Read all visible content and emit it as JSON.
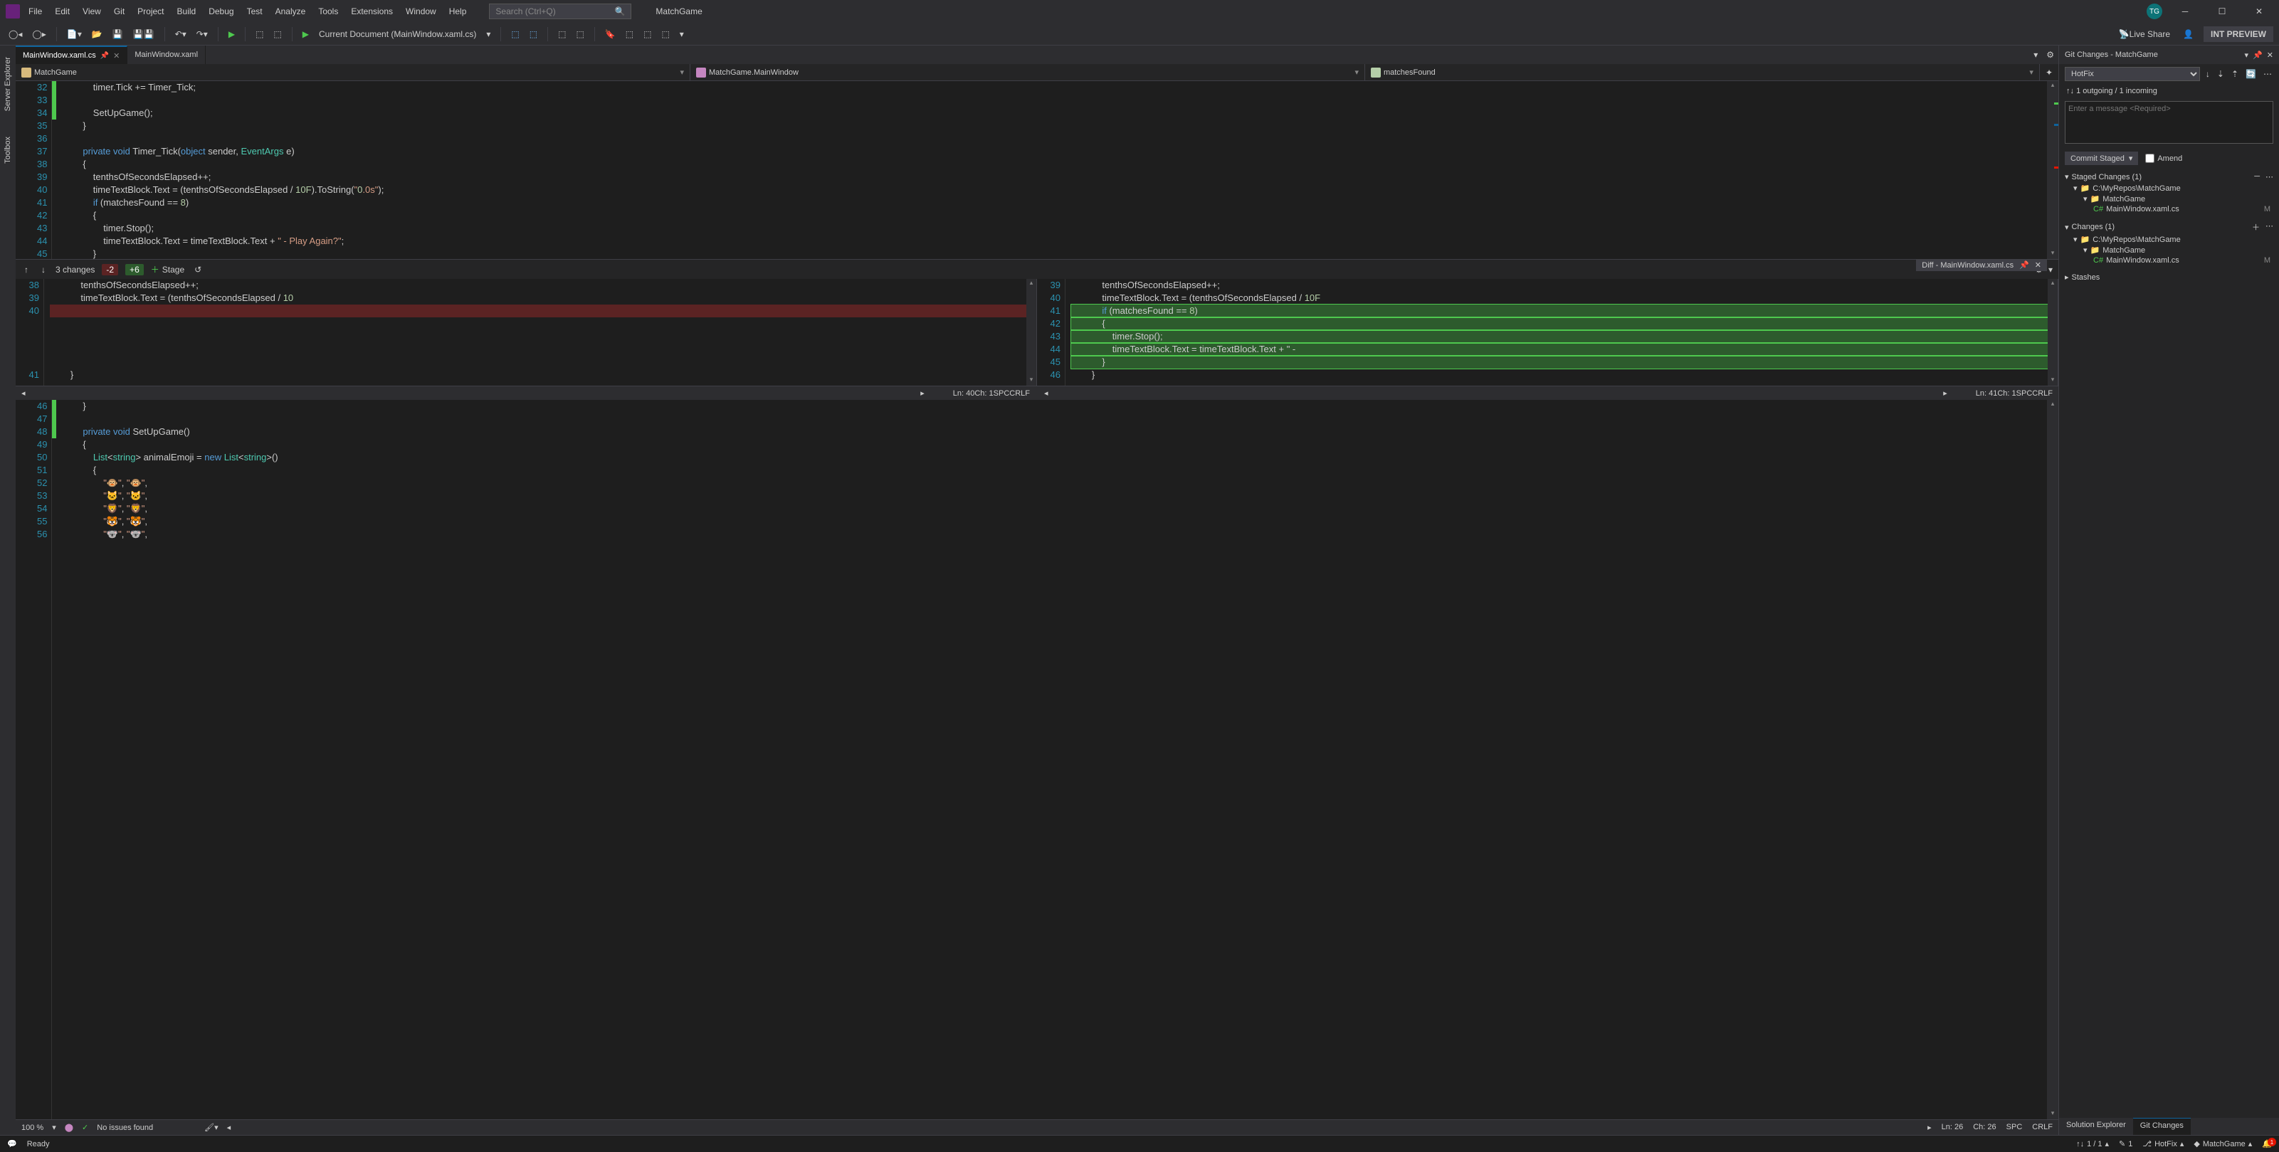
{
  "titlebar": {
    "menus": [
      "File",
      "Edit",
      "View",
      "Git",
      "Project",
      "Build",
      "Debug",
      "Test",
      "Analyze",
      "Tools",
      "Extensions",
      "Window",
      "Help"
    ],
    "search_placeholder": "Search (Ctrl+Q)",
    "solution_name": "MatchGame",
    "avatar": "TG"
  },
  "toolbar": {
    "current_doc": "Current Document (MainWindow.xaml.cs)",
    "live_share": "Live Share",
    "int_preview": "INT PREVIEW"
  },
  "sidebar": {
    "tabs": [
      "Server Explorer",
      "Toolbox"
    ]
  },
  "editor_tabs": [
    {
      "label": "MainWindow.xaml.cs",
      "active": true,
      "pinned": true
    },
    {
      "label": "MainWindow.xaml",
      "active": false,
      "pinned": false
    }
  ],
  "nav": {
    "namespace": "MatchGame",
    "class": "MatchGame.MainWindow",
    "member": "matchesFound"
  },
  "code_upper": {
    "lines": [
      {
        "n": 32,
        "txt": "            timer.Tick += Timer_Tick;"
      },
      {
        "n": 33,
        "txt": ""
      },
      {
        "n": 34,
        "txt": "            SetUpGame();"
      },
      {
        "n": 35,
        "txt": "        }"
      },
      {
        "n": 36,
        "txt": ""
      },
      {
        "n": 37,
        "txt": "        private void Timer_Tick(object sender, EventArgs e)"
      },
      {
        "n": 38,
        "txt": "        {"
      },
      {
        "n": 39,
        "txt": "            tenthsOfSecondsElapsed++;"
      },
      {
        "n": 40,
        "txt": "            timeTextBlock.Text = (tenthsOfSecondsElapsed / 10F).ToString(\"0.0s\");"
      },
      {
        "n": 41,
        "txt": "            if (matchesFound == 8)"
      },
      {
        "n": 42,
        "txt": "            {"
      },
      {
        "n": 43,
        "txt": "                timer.Stop();"
      },
      {
        "n": 44,
        "txt": "                timeTextBlock.Text = timeTextBlock.Text + \" - Play Again?\";"
      },
      {
        "n": 45,
        "txt": "            }"
      }
    ]
  },
  "diff": {
    "title": "Diff - MainWindow.xaml.cs",
    "changes": "3 changes",
    "minus": "-2",
    "plus": "+6",
    "stage": "Stage",
    "left": {
      "lines": [
        {
          "n": 38,
          "txt": "            tenthsOfSecondsElapsed++;"
        },
        {
          "n": 39,
          "txt": "            timeTextBlock.Text = (tenthsOfSecondsElapsed / 10"
        },
        {
          "n": 40,
          "txt": "",
          "del": true
        },
        {
          "n": "",
          "txt": ""
        },
        {
          "n": "",
          "txt": ""
        },
        {
          "n": "",
          "txt": ""
        },
        {
          "n": "",
          "txt": ""
        },
        {
          "n": 41,
          "txt": "        }"
        }
      ],
      "status": {
        "ln": "Ln: 40",
        "ch": "Ch: 1",
        "enc": "SPC",
        "eol": "CRLF"
      }
    },
    "right": {
      "lines": [
        {
          "n": 39,
          "txt": "            tenthsOfSecondsElapsed++;"
        },
        {
          "n": 40,
          "txt": "            timeTextBlock.Text = (tenthsOfSecondsElapsed / 10F"
        },
        {
          "n": 41,
          "txt": "            if (matchesFound == 8)",
          "add": true
        },
        {
          "n": 42,
          "txt": "            {",
          "add": true
        },
        {
          "n": 43,
          "txt": "                timer.Stop();",
          "add": true
        },
        {
          "n": 44,
          "txt": "                timeTextBlock.Text = timeTextBlock.Text + \" - ",
          "add": true
        },
        {
          "n": 45,
          "txt": "            }",
          "add": true
        },
        {
          "n": 46,
          "txt": "        }"
        }
      ],
      "status": {
        "ln": "Ln: 41",
        "ch": "Ch: 1",
        "enc": "SPC",
        "eol": "CRLF"
      }
    }
  },
  "code_lower": {
    "lines": [
      {
        "n": 46,
        "txt": "        }"
      },
      {
        "n": 47,
        "txt": ""
      },
      {
        "n": 48,
        "txt": "        private void SetUpGame()"
      },
      {
        "n": 49,
        "txt": "        {"
      },
      {
        "n": 50,
        "txt": "            List<string> animalEmoji = new List<string>()"
      },
      {
        "n": 51,
        "txt": "            {"
      },
      {
        "n": 52,
        "txt": "                \"🐵\", \"🐵\","
      },
      {
        "n": 53,
        "txt": "                \"🐱\", \"🐱\","
      },
      {
        "n": 54,
        "txt": "                \"🦁\", \"🦁\","
      },
      {
        "n": 55,
        "txt": "                \"🐯\", \"🐯\","
      },
      {
        "n": 56,
        "txt": "                \"🐨\", \"🐨\","
      }
    ]
  },
  "editor_status": {
    "zoom": "100 %",
    "issues": "No issues found",
    "ln": "Ln: 26",
    "ch": "Ch: 26",
    "enc": "SPC",
    "eol": "CRLF"
  },
  "git": {
    "header": "Git Changes - MatchGame",
    "branch": "HotFix",
    "sync": "1 outgoing / 1 incoming",
    "msg_placeholder": "Enter a message <Required>",
    "commit_btn": "Commit Staged",
    "amend": "Amend",
    "staged": {
      "label": "Staged Changes (1)",
      "repo": "C:\\MyRepos\\MatchGame",
      "project": "MatchGame",
      "file": "MainWindow.xaml.cs",
      "status": "M"
    },
    "changes": {
      "label": "Changes (1)",
      "repo": "C:\\MyRepos\\MatchGame",
      "project": "MatchGame",
      "file": "MainWindow.xaml.cs",
      "status": "M"
    },
    "stashes": "Stashes",
    "bottom_tabs": [
      "Solution Explorer",
      "Git Changes"
    ]
  },
  "statusbar": {
    "ready": "Ready",
    "sync": "1 / 1",
    "pencil": "1",
    "branch": "HotFix",
    "repo": "MatchGame",
    "notif": "1"
  }
}
